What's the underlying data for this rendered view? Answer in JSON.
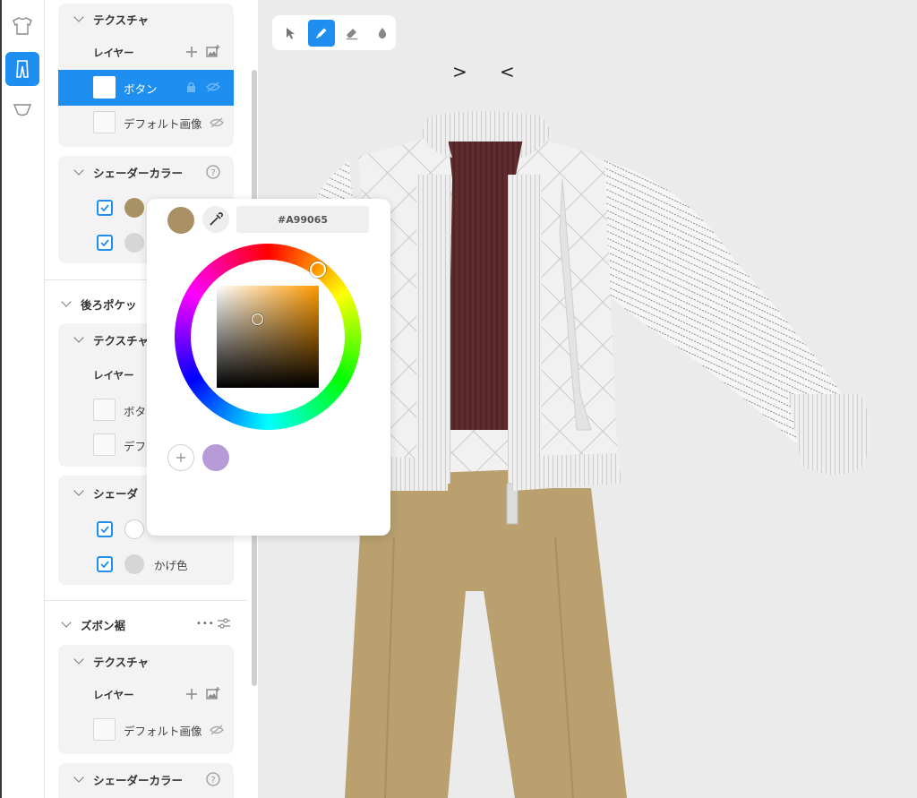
{
  "sidebar_rail": {
    "items": [
      {
        "icon": "shirt-icon"
      },
      {
        "icon": "pants-icon",
        "active": true
      },
      {
        "icon": "shoe-icon"
      }
    ]
  },
  "panel": {
    "section1": {
      "texture_title": "テクスチャ",
      "layer_label": "レイヤー",
      "layers": [
        {
          "name": "ボタン",
          "selected": true
        },
        {
          "name": "デフォルト画像"
        }
      ],
      "shader_title": "シェーダーカラー"
    },
    "section2": {
      "title": "後ろポケッ",
      "texture_title": "テクスチャ",
      "layer_label": "レイヤー",
      "layers": [
        {
          "name": "ボタ"
        },
        {
          "name": "デフ"
        }
      ],
      "shader_title": "シェーダ",
      "shade_label": "かげ色"
    },
    "section3": {
      "title": "ズボン裾",
      "more": "•••",
      "texture_title": "テクスチャ",
      "layer_label": "レイヤー",
      "layers": [
        {
          "name": "デフォルト画像"
        }
      ],
      "shader_title": "シェーダーカラー"
    },
    "colors": {
      "accent": "#1E8FF0",
      "swatch_tan": "#A99065",
      "swatch_grey": "#D6D6D6",
      "swatch_white": "#FFFFFF"
    }
  },
  "toolbar": {
    "tools": [
      "select-tool-icon",
      "pen-tool-icon",
      "eraser-tool-icon",
      "fill-tool-icon"
    ],
    "active": "pen-tool-icon"
  },
  "viewport": {
    "markers": [
      ">",
      "<"
    ]
  },
  "color_picker": {
    "current_color": "#A99065",
    "hex": "#A99065",
    "saved_colors": [
      "#B79BD8"
    ]
  }
}
